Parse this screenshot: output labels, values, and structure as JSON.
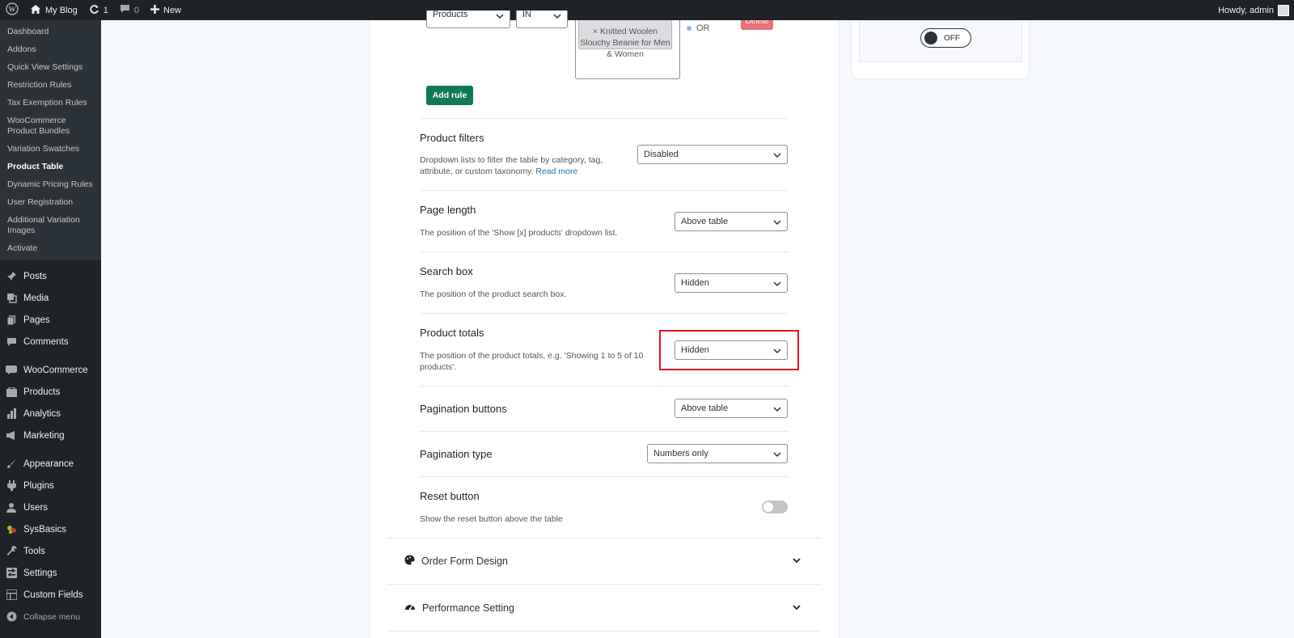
{
  "adminbar": {
    "site_name": "My Blog",
    "updates_count": "1",
    "comments_count": "0",
    "new_label": "New",
    "howdy": "Howdy, admin"
  },
  "sidebar": {
    "submenu": [
      {
        "label": "Dashboard"
      },
      {
        "label": "Addons"
      },
      {
        "label": "Quick View Settings"
      },
      {
        "label": "Restriction Rules"
      },
      {
        "label": "Tax Exemption Rules"
      },
      {
        "label": "WooCommerce Product Bundles"
      },
      {
        "label": "Variation Swatches"
      },
      {
        "label": "Product Table"
      },
      {
        "label": "Dynamic Pricing Rules"
      },
      {
        "label": "User Registration"
      },
      {
        "label": "Additional Variation Images"
      },
      {
        "label": "Activate"
      }
    ],
    "menu": [
      {
        "label": "Posts",
        "icon": "pin-icon"
      },
      {
        "label": "Media",
        "icon": "media-icon"
      },
      {
        "label": "Pages",
        "icon": "pages-icon"
      },
      {
        "label": "Comments",
        "icon": "comments-icon"
      },
      {
        "label": "WooCommerce",
        "icon": "woocommerce-icon"
      },
      {
        "label": "Products",
        "icon": "products-icon"
      },
      {
        "label": "Analytics",
        "icon": "analytics-icon"
      },
      {
        "label": "Marketing",
        "icon": "megaphone-icon"
      },
      {
        "label": "Appearance",
        "icon": "brush-icon"
      },
      {
        "label": "Plugins",
        "icon": "plugin-icon"
      },
      {
        "label": "Users",
        "icon": "users-icon"
      },
      {
        "label": "SysBasics",
        "icon": "sysbasics-icon"
      },
      {
        "label": "Tools",
        "icon": "wrench-icon"
      },
      {
        "label": "Settings",
        "icon": "settings-icon"
      },
      {
        "label": "Custom Fields",
        "icon": "grid-icon"
      }
    ],
    "collapse_label": "Collapse menu"
  },
  "rule": {
    "field_value": "Products",
    "operator_value": "IN",
    "product_chip": "× Knitted Woolen Slouchy Beanie for Men & Women",
    "or_label": "OR",
    "delete_label": "Delete",
    "add_rule_label": "Add rule"
  },
  "toggle_card": {
    "state_label": "OFF"
  },
  "settings": {
    "product_filters": {
      "title": "Product filters",
      "desc": "Dropdown lists to filter the table by category, tag, attribute, or custom taxonomy.",
      "link": "Read more",
      "value": "Disabled"
    },
    "page_length": {
      "title": "Page length",
      "desc": "The position of the 'Show [x] products' dropdown list.",
      "value": "Above table"
    },
    "search_box": {
      "title": "Search box",
      "desc": "The position of the product search box.",
      "value": "Hidden"
    },
    "product_totals": {
      "title": "Product totals",
      "desc": "The position of the product totals, e.g. 'Showing 1 to 5 of 10 products'.",
      "value": "Hidden"
    },
    "pagination_buttons": {
      "title": "Pagination buttons",
      "value": "Above table"
    },
    "pagination_type": {
      "title": "Pagination type",
      "value": "Numbers only"
    },
    "reset_button": {
      "title": "Reset button",
      "desc": "Show the reset button above the table",
      "enabled": false
    }
  },
  "accordions": [
    {
      "title": "Order Form Design",
      "icon": "palette-icon"
    },
    {
      "title": "Performance Setting",
      "icon": "dashboard-icon"
    }
  ],
  "colors": {
    "admin_bg": "#1d2327",
    "accent_green": "#0f7a55",
    "highlight_red": "#e3161b",
    "link_blue": "#2271b1"
  }
}
